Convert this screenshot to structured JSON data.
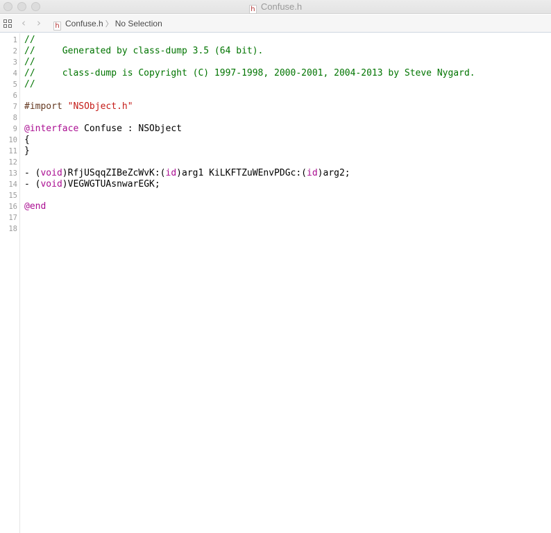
{
  "window": {
    "title": "Confuse.h",
    "file_icon_glyph": "h"
  },
  "jumpbar": {
    "grid_icon": "related-items-grid-icon",
    "back_arrow": "‹",
    "forward_arrow": "›",
    "file_name": "Confuse.h",
    "separator": "〉",
    "selection": "No Selection"
  },
  "editor": {
    "colors": {
      "comment": "#007400",
      "preprocessor": "#643820",
      "string": "#c41a16",
      "keyword": "#aa0d91",
      "plain": "#000000"
    },
    "lines": [
      {
        "number": "1",
        "tokens": [
          {
            "type": "comment",
            "text": "//"
          }
        ]
      },
      {
        "number": "2",
        "tokens": [
          {
            "type": "comment",
            "text": "//     Generated by class-dump 3.5 (64 bit)."
          }
        ]
      },
      {
        "number": "3",
        "tokens": [
          {
            "type": "comment",
            "text": "//"
          }
        ]
      },
      {
        "number": "4",
        "tokens": [
          {
            "type": "comment",
            "text": "//     class-dump is Copyright (C) 1997-1998, 2000-2001, 2004-2013 by Steve Nygard."
          }
        ]
      },
      {
        "number": "5",
        "tokens": [
          {
            "type": "comment",
            "text": "//"
          }
        ]
      },
      {
        "number": "6",
        "tokens": []
      },
      {
        "number": "7",
        "tokens": [
          {
            "type": "preproc",
            "text": "#import "
          },
          {
            "type": "string",
            "text": "\"NSObject.h\""
          }
        ]
      },
      {
        "number": "8",
        "tokens": []
      },
      {
        "number": "9",
        "tokens": [
          {
            "type": "keyword",
            "text": "@interface"
          },
          {
            "type": "plain",
            "text": " Confuse : NSObject"
          }
        ]
      },
      {
        "number": "10",
        "tokens": [
          {
            "type": "plain",
            "text": "{"
          }
        ]
      },
      {
        "number": "11",
        "tokens": [
          {
            "type": "plain",
            "text": "}"
          }
        ]
      },
      {
        "number": "12",
        "tokens": []
      },
      {
        "number": "13",
        "tokens": [
          {
            "type": "plain",
            "text": "- ("
          },
          {
            "type": "keyword",
            "text": "void"
          },
          {
            "type": "plain",
            "text": ")RfjUSqqZIBeZcWvK:("
          },
          {
            "type": "keyword",
            "text": "id"
          },
          {
            "type": "plain",
            "text": ")arg1 KiLKFTZuWEnvPDGc:("
          },
          {
            "type": "keyword",
            "text": "id"
          },
          {
            "type": "plain",
            "text": ")arg2;"
          }
        ]
      },
      {
        "number": "14",
        "tokens": [
          {
            "type": "plain",
            "text": "- ("
          },
          {
            "type": "keyword",
            "text": "void"
          },
          {
            "type": "plain",
            "text": ")VEGWGTUAsnwarEGK;"
          }
        ]
      },
      {
        "number": "15",
        "tokens": []
      },
      {
        "number": "16",
        "tokens": [
          {
            "type": "keyword",
            "text": "@end"
          }
        ]
      },
      {
        "number": "17",
        "tokens": []
      },
      {
        "number": "18",
        "tokens": []
      }
    ]
  }
}
